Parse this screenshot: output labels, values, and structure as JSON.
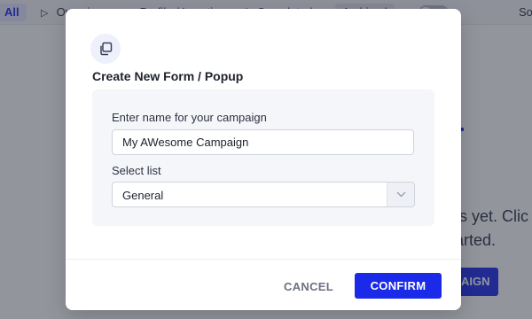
{
  "background": {
    "tabs": [
      "All",
      "Overview",
      "Profile / Location",
      "Completed",
      "Archived"
    ],
    "sort_label": "So",
    "empty_line_1": "ns yet. Clic",
    "empty_line_2": "tarted.",
    "cta_label": "AIGN"
  },
  "modal": {
    "icon": "copy-icon",
    "title": "Create New Form / Popup",
    "name_label": "Enter name for your campaign",
    "name_value": "My AWesome Campaign",
    "list_label": "Select list",
    "list_value": "General",
    "cancel_label": "CANCEL",
    "confirm_label": "CONFIRM"
  },
  "colors": {
    "accent": "#1a2ae8",
    "backdrop": "rgba(40,44,60,0.5)",
    "panel": "#f5f6f9"
  }
}
